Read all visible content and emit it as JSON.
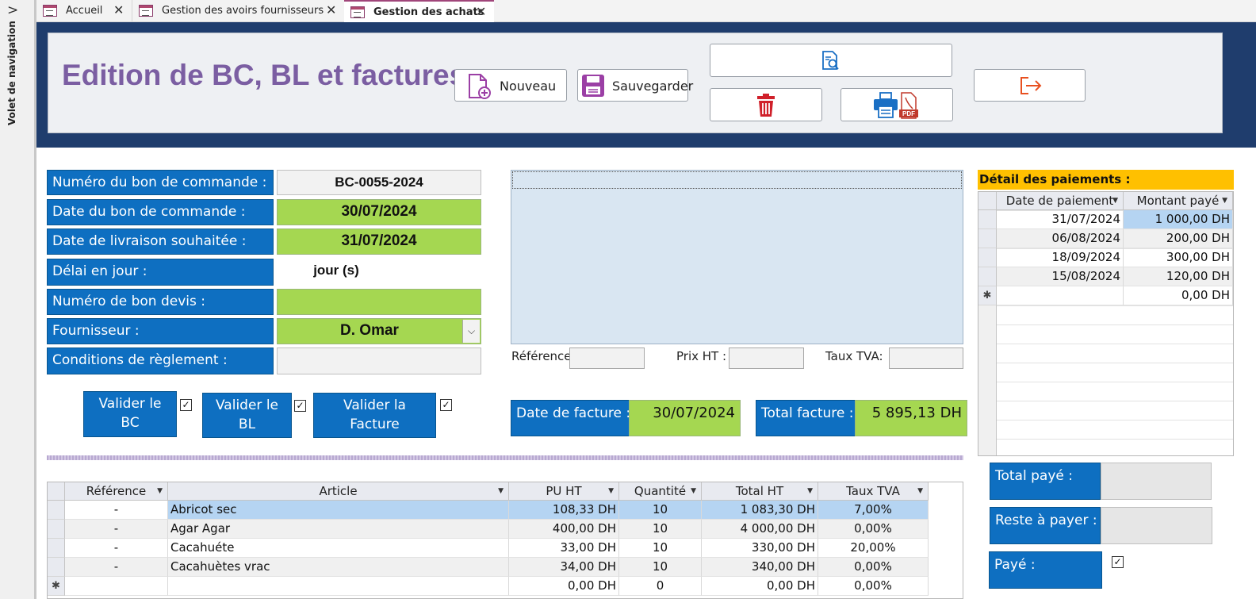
{
  "nav": {
    "pane_label": "Volet de navigation"
  },
  "tabs": [
    {
      "label": "Accueil"
    },
    {
      "label": "Gestion des avoirs fournisseurs"
    },
    {
      "label": "Gestion des achats"
    }
  ],
  "header": {
    "title": "Edition de BC, BL et factures"
  },
  "toolbar": {
    "new_label": "Nouveau",
    "save_label": "Sauvegarder"
  },
  "form": {
    "bc_number_label": "Numéro du bon de commande :",
    "bc_number_value": "BC-0055-2024",
    "bc_date_label": "Date du bon de commande :",
    "bc_date_value": "30/07/2024",
    "delivery_date_label": "Date de livraison souhaitée :",
    "delivery_date_value": "31/07/2024",
    "delay_label": "Délai en jour :",
    "delay_value": "jour (s)",
    "quote_label": "Numéro de bon devis :",
    "quote_value": "",
    "supplier_label": "Fournisseur :",
    "supplier_value": "D. Omar",
    "conditions_label": "Conditions de règlement :",
    "conditions_value": ""
  },
  "validation": {
    "bc": {
      "line1": "Valider le",
      "line2": "BC",
      "checked": "✓"
    },
    "bl": {
      "line1": "Valider le",
      "line2": "BL",
      "checked": "✓"
    },
    "facture": {
      "line1": "Valider la",
      "line2": "Facture",
      "checked": "✓"
    }
  },
  "detail_fields": {
    "reference_label": "Référence",
    "price_label": "Prix HT :",
    "vat_label": "Taux TVA:"
  },
  "invoice": {
    "date_label": "Date de facture :",
    "date_value": "30/07/2024",
    "total_label": "Total facture :",
    "total_value": "5 895,13 DH"
  },
  "articles": {
    "columns": [
      "Référence",
      "Article",
      "PU HT",
      "Quantité",
      "Total HT",
      "Taux TVA"
    ],
    "rows": [
      [
        "-",
        "Abricot sec",
        "108,33 DH",
        "10",
        "1 083,30 DH",
        "7,00%"
      ],
      [
        "-",
        "Agar Agar",
        "400,00 DH",
        "10",
        "4 000,00 DH",
        "0,00%"
      ],
      [
        "-",
        "Cacahuéte",
        "33,00 DH",
        "10",
        "330,00 DH",
        "20,00%"
      ],
      [
        "-",
        "Cacahuètes vrac",
        "34,00 DH",
        "10",
        "340,00 DH",
        "0,00%"
      ]
    ],
    "new_row": [
      "",
      "",
      "0,00 DH",
      "0",
      "0,00 DH",
      "0,00%"
    ],
    "new_row_marker": "✱"
  },
  "payments": {
    "title": "Détail des paiements :",
    "columns": [
      "Date de paiement",
      "Montant payé"
    ],
    "rows": [
      [
        "31/07/2024",
        "1 000,00 DH"
      ],
      [
        "06/08/2024",
        "200,00 DH"
      ],
      [
        "18/09/2024",
        "300,00 DH"
      ],
      [
        "15/08/2024",
        "120,00 DH"
      ]
    ],
    "new_row": [
      "",
      "0,00 DH"
    ],
    "new_row_marker": "✱"
  },
  "summary": {
    "total_paid_label": "Total payé :",
    "total_paid_value": "",
    "remaining_label": "Reste à payer :",
    "remaining_value": "",
    "paid_label": "Payé :",
    "paid_checked": "✓"
  },
  "colors": {
    "accent_blue": "#0e6fc1",
    "header_navy": "#1f3d6d",
    "field_green": "#a5d751",
    "title_purple": "#7b5ea2",
    "payments_title_bg": "#ffc000"
  }
}
